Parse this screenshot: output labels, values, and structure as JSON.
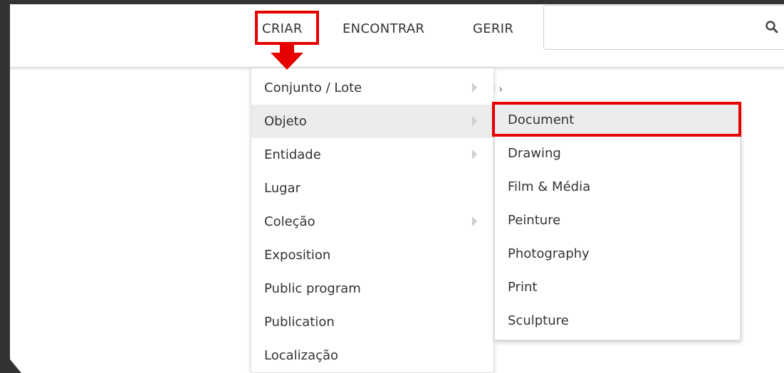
{
  "nav": {
    "items": [
      "CRIAR",
      "ENCONTRAR",
      "GERIR"
    ]
  },
  "search": {
    "placeholder": "",
    "icon": "search-icon"
  },
  "breadcrumb": {
    "fragment": "d ›"
  },
  "menu": {
    "items": [
      {
        "label": "Conjunto / Lote",
        "has_submenu": true
      },
      {
        "label": "Objeto",
        "has_submenu": true,
        "active": true
      },
      {
        "label": "Entidade",
        "has_submenu": true
      },
      {
        "label": "Lugar",
        "has_submenu": false
      },
      {
        "label": "Coleção",
        "has_submenu": true
      },
      {
        "label": "Exposition",
        "has_submenu": false
      },
      {
        "label": "Public program",
        "has_submenu": false
      },
      {
        "label": "Publication",
        "has_submenu": false
      },
      {
        "label": "Localização",
        "has_submenu": false
      }
    ]
  },
  "submenu": {
    "items": [
      {
        "label": "Document",
        "active": true
      },
      {
        "label": "Drawing"
      },
      {
        "label": "Film & Média"
      },
      {
        "label": "Peinture"
      },
      {
        "label": "Photography"
      },
      {
        "label": "Print"
      },
      {
        "label": "Sculpture"
      }
    ]
  },
  "colors": {
    "annotation_red": "#e60000",
    "hover_bg": "#ececec",
    "text": "#333333",
    "frame": "#333333"
  }
}
